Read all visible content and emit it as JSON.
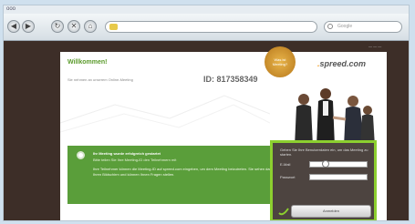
{
  "window": {
    "title": "ooo"
  },
  "browser": {
    "nav_buttons": [
      "back-icon",
      "forward-icon",
      "reload-icon",
      "stop-icon",
      "home-icon"
    ],
    "search_placeholder": "Google"
  },
  "page": {
    "welcome": "Willkommen!",
    "subtitle": "Sie nehmen an unserem Online-Meeting",
    "meeting_id": "ID: 817358349",
    "badge_line1": "Was ist",
    "badge_line2": "Meeting?",
    "logo_brand": "spreed.com",
    "green_heading": "Ihr Meeting wurde erfolgreich gestartet",
    "green_subheading": "Bitte teilen Sie Ihre Meeting-ID den Teilnehmern mit",
    "green_body": "Ihre Teilnehmer können die Meeting-ID auf spreed.com eingeben, um dem Meeting beizutreten. Sie sehen dann Ihren Bildschirm und können Ihnen Fragen stellen.",
    "login_heading": "Geben Sie Ihre Benutzerdaten ein, um das Meeting zu starten.",
    "login_email_label": "E-Mail",
    "login_password_label": "Passwort",
    "login_button": "Anmelden"
  },
  "colors": {
    "accent_green": "#5a9e3a",
    "highlight_green": "#8ccf2f",
    "badge_gold": "#c88b25",
    "background_brown": "#3d2e28"
  }
}
